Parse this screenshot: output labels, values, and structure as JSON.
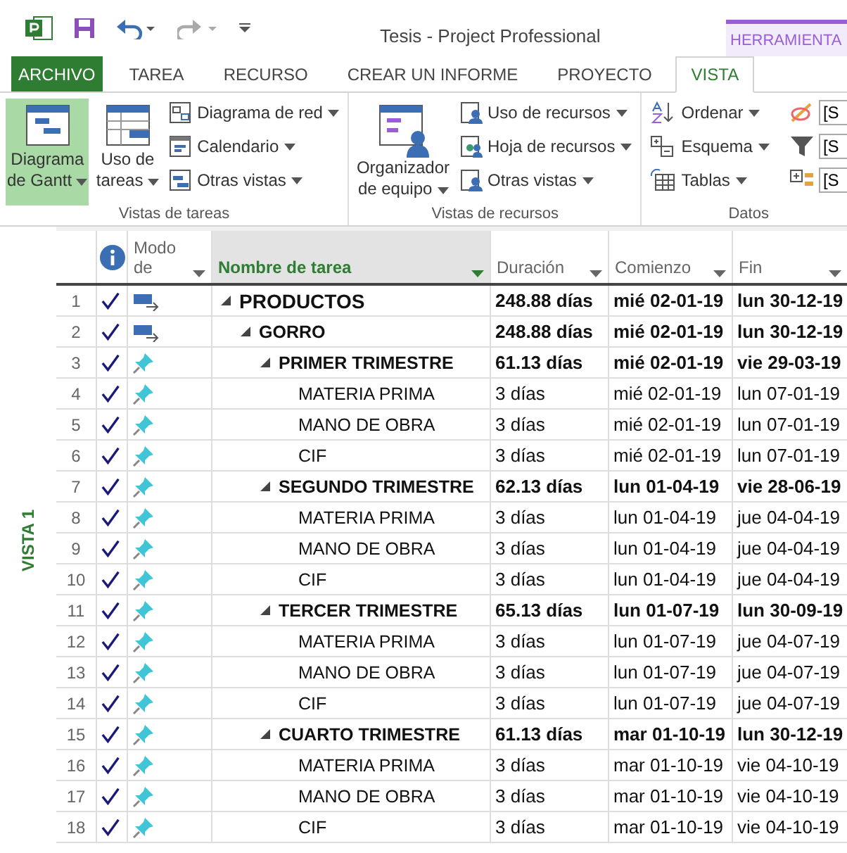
{
  "window": {
    "title": "Tesis - Project Professional",
    "context_tab": "HERRAMIENTA"
  },
  "tabs": [
    {
      "label": "ARCHIVO",
      "kind": "file",
      "selected": false
    },
    {
      "label": "TAREA",
      "kind": "tab",
      "selected": false
    },
    {
      "label": "RECURSO",
      "kind": "tab",
      "selected": false
    },
    {
      "label": "CREAR UN INFORME",
      "kind": "tab",
      "selected": false
    },
    {
      "label": "PROYECTO",
      "kind": "tab",
      "selected": false
    },
    {
      "label": "VISTA",
      "kind": "tab",
      "selected": true
    }
  ],
  "ribbon": {
    "groups": [
      {
        "label": "Vistas de tareas",
        "large": [
          {
            "lines": [
              "Diagrama",
              "de Gantt"
            ],
            "selected": true
          },
          {
            "lines": [
              "Uso de",
              "tareas"
            ],
            "selected": false
          }
        ],
        "small": [
          {
            "label": "Diagrama de red"
          },
          {
            "label": "Calendario"
          },
          {
            "label": "Otras vistas"
          }
        ]
      },
      {
        "label": "Vistas de recursos",
        "large": [
          {
            "lines": [
              "Organizador",
              "de equipo"
            ],
            "selected": false
          }
        ],
        "small": [
          {
            "label": "Uso de recursos"
          },
          {
            "label": "Hoja de recursos"
          },
          {
            "label": "Otras vistas"
          }
        ]
      },
      {
        "label": "Datos",
        "small": [
          {
            "label": "Ordenar"
          },
          {
            "label": "Esquema"
          },
          {
            "label": "Tablas"
          }
        ],
        "fields": [
          "[S",
          "[S",
          "[S"
        ]
      }
    ]
  },
  "side_label": "VISTA 1",
  "table": {
    "columns": [
      "Modo de",
      "Nombre de tarea",
      "Duración",
      "Comienzo",
      "Fin"
    ],
    "rows": [
      {
        "id": "1",
        "name": "PRODUCTOS",
        "duration": "248.88 días",
        "start": "mié 02-01-19",
        "finish": "lun 30-12-19",
        "manual": false,
        "complete": true,
        "expanded": true,
        "children": [
          {
            "id": "2",
            "name": "GORRO",
            "duration": "248.88 días",
            "start": "mié 02-01-19",
            "finish": "lun 30-12-19",
            "manual": false,
            "complete": true,
            "expanded": true,
            "children": [
              {
                "id": "3",
                "name": "PRIMER TRIMESTRE",
                "duration": "61.13 días",
                "start": "mié 02-01-19",
                "finish": "vie 29-03-19",
                "manual": true,
                "complete": true,
                "expanded": true,
                "children": [
                  {
                    "id": "4",
                    "name": "MATERIA PRIMA",
                    "duration": "3 días",
                    "start": "mié 02-01-19",
                    "finish": "lun 07-01-19",
                    "manual": true,
                    "complete": true
                  },
                  {
                    "id": "5",
                    "name": "MANO DE OBRA",
                    "duration": "3 días",
                    "start": "mié 02-01-19",
                    "finish": "lun 07-01-19",
                    "manual": true,
                    "complete": true
                  },
                  {
                    "id": "6",
                    "name": "CIF",
                    "duration": "3 días",
                    "start": "mié 02-01-19",
                    "finish": "lun 07-01-19",
                    "manual": true,
                    "complete": true
                  }
                ]
              },
              {
                "id": "7",
                "name": "SEGUNDO TRIMESTRE",
                "duration": "62.13 días",
                "start": "lun 01-04-19",
                "finish": "vie 28-06-19",
                "manual": true,
                "complete": true,
                "expanded": true,
                "children": [
                  {
                    "id": "8",
                    "name": "MATERIA PRIMA",
                    "duration": "3 días",
                    "start": "lun 01-04-19",
                    "finish": "jue 04-04-19",
                    "manual": true,
                    "complete": true
                  },
                  {
                    "id": "9",
                    "name": "MANO DE OBRA",
                    "duration": "3 días",
                    "start": "lun 01-04-19",
                    "finish": "jue 04-04-19",
                    "manual": true,
                    "complete": true
                  },
                  {
                    "id": "10",
                    "name": "CIF",
                    "duration": "3 días",
                    "start": "lun 01-04-19",
                    "finish": "jue 04-04-19",
                    "manual": true,
                    "complete": true
                  }
                ]
              },
              {
                "id": "11",
                "name": "TERCER TRIMESTRE",
                "duration": "65.13 días",
                "start": "lun 01-07-19",
                "finish": "lun 30-09-19",
                "manual": true,
                "complete": true,
                "expanded": true,
                "children": [
                  {
                    "id": "12",
                    "name": "MATERIA PRIMA",
                    "duration": "3 días",
                    "start": "lun 01-07-19",
                    "finish": "jue 04-07-19",
                    "manual": true,
                    "complete": true
                  },
                  {
                    "id": "13",
                    "name": "MANO DE OBRA",
                    "duration": "3 días",
                    "start": "lun 01-07-19",
                    "finish": "jue 04-07-19",
                    "manual": true,
                    "complete": true
                  },
                  {
                    "id": "14",
                    "name": "CIF",
                    "duration": "3 días",
                    "start": "lun 01-07-19",
                    "finish": "jue 04-07-19",
                    "manual": true,
                    "complete": true
                  }
                ]
              },
              {
                "id": "15",
                "name": "CUARTO TRIMESTRE",
                "duration": "61.13 días",
                "start": "mar 01-10-19",
                "finish": "lun 30-12-19",
                "manual": true,
                "complete": true,
                "expanded": true,
                "children": [
                  {
                    "id": "16",
                    "name": "MATERIA PRIMA",
                    "duration": "3 días",
                    "start": "mar 01-10-19",
                    "finish": "vie 04-10-19",
                    "manual": true,
                    "complete": true
                  },
                  {
                    "id": "17",
                    "name": "MANO DE OBRA",
                    "duration": "3 días",
                    "start": "mar 01-10-19",
                    "finish": "vie 04-10-19",
                    "manual": true,
                    "complete": true
                  },
                  {
                    "id": "18",
                    "name": "CIF",
                    "duration": "3 días",
                    "start": "mar 01-10-19",
                    "finish": "vie 04-10-19",
                    "manual": true,
                    "complete": true
                  }
                ]
              }
            ]
          }
        ]
      }
    ]
  }
}
